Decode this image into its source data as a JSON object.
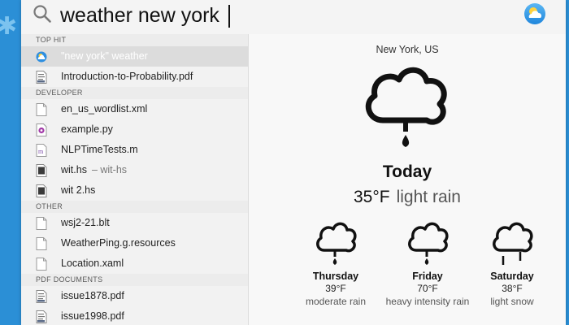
{
  "search": {
    "query": "weather new york"
  },
  "results": {
    "sections": [
      {
        "title": "TOP HIT",
        "items": [
          {
            "label": "\"new york\" weather",
            "icon": "weather-icon",
            "selected": true
          },
          {
            "label": "Introduction-to-Probability.pdf",
            "icon": "pdf-document-icon"
          }
        ]
      },
      {
        "title": "DEVELOPER",
        "items": [
          {
            "label": "en_us_wordlist.xml",
            "icon": "document-icon"
          },
          {
            "label": "example.py",
            "icon": "python-file-icon"
          },
          {
            "label": "NLPTimeTests.m",
            "icon": "objc-file-icon"
          },
          {
            "label": "wit.hs",
            "sublabel": "– wit-hs",
            "icon": "haskell-file-icon"
          },
          {
            "label": "wit 2.hs",
            "icon": "haskell-file-icon"
          }
        ]
      },
      {
        "title": "OTHER",
        "items": [
          {
            "label": "wsj2-21.blt",
            "icon": "document-icon"
          },
          {
            "label": "WeatherPing.g.resources",
            "icon": "document-icon"
          },
          {
            "label": "Location.xaml",
            "icon": "document-icon"
          }
        ]
      },
      {
        "title": "PDF DOCUMENTS",
        "items": [
          {
            "label": "issue1878.pdf",
            "icon": "pdf-document-icon"
          },
          {
            "label": "issue1998.pdf",
            "icon": "pdf-document-icon"
          }
        ]
      }
    ]
  },
  "preview": {
    "location": "New York, US",
    "today": {
      "label": "Today",
      "temp": "35°F",
      "condition": "light rain"
    },
    "forecast": [
      {
        "day": "Thursday",
        "temp": "39°F",
        "condition": "moderate rain",
        "icon": "cloud-rain-icon"
      },
      {
        "day": "Friday",
        "temp": "70°F",
        "condition": "heavy intensity rain",
        "icon": "cloud-rain-icon"
      },
      {
        "day": "Saturday",
        "temp": "38°F",
        "condition": "light snow",
        "icon": "cloud-snow-icon"
      }
    ]
  },
  "colors": {
    "desktop": "#2b8fd6",
    "selection": "#dcdcdc"
  }
}
